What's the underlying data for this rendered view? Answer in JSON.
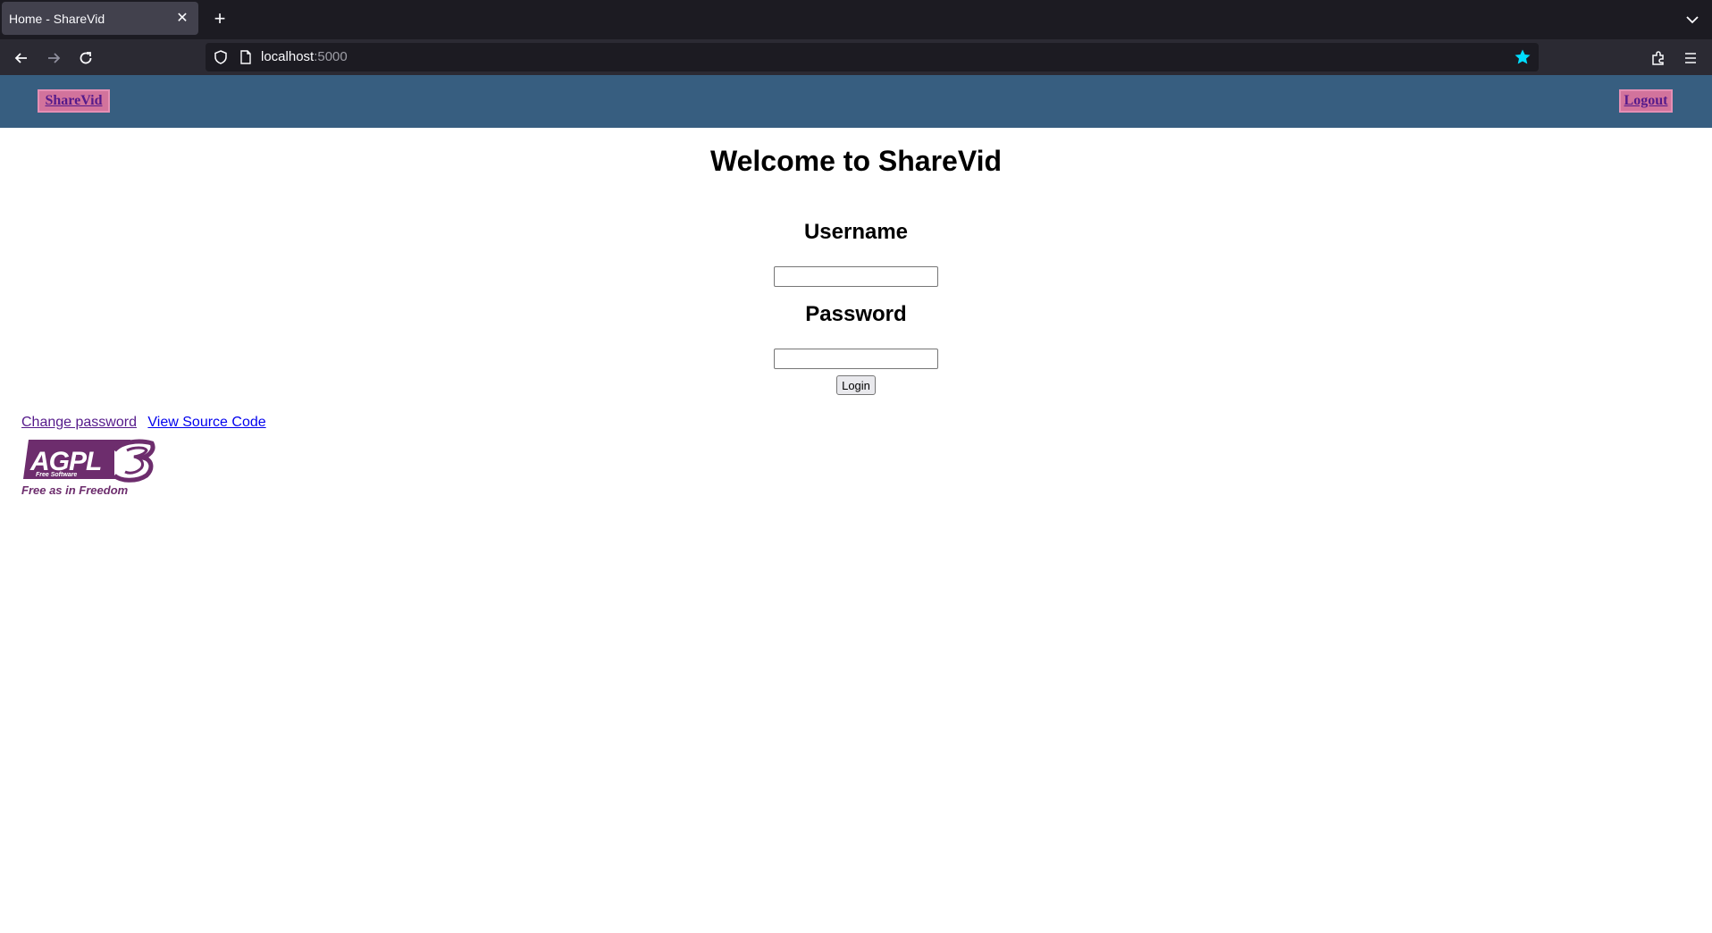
{
  "browser": {
    "tab_title": "Home - ShareVid",
    "url_host": "localhost",
    "url_port": ":5000",
    "icons": [
      "close-icon",
      "plus-icon",
      "chevron-down-icon",
      "back-arrow-icon",
      "forward-arrow-icon",
      "reload-icon",
      "shield-icon",
      "page-icon",
      "star-icon",
      "extensions-icon",
      "hamburger-menu-icon"
    ],
    "accent_star_color": "#00ddff"
  },
  "header": {
    "home_label": "ShareVid",
    "logout_label": "Logout",
    "bar_color": "#375e80",
    "button_color": "#d2739c"
  },
  "main": {
    "title": "Welcome to ShareVid",
    "username_label": "Username",
    "password_label": "Password",
    "username_value": "",
    "password_value": "",
    "login_label": "Login"
  },
  "footer": {
    "change_password_label": "Change password",
    "source_code_label": "View Source Code",
    "logo": {
      "main_text": "AGPLv3",
      "sub_text": "Free Software",
      "tagline": "Free as in Freedom"
    }
  }
}
